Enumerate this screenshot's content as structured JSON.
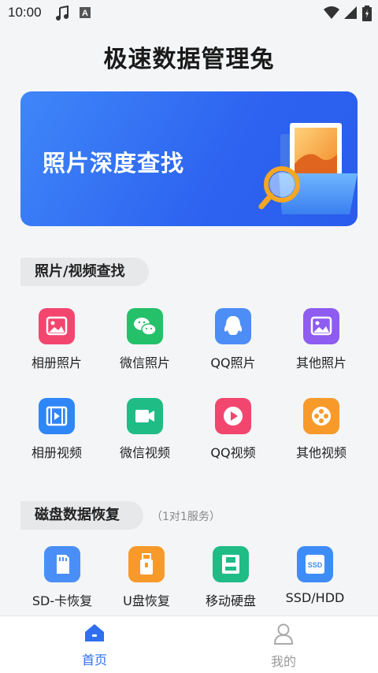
{
  "status_bar": {
    "time": "10:00"
  },
  "app_title": "极速数据管理兔",
  "banner": {
    "title": "照片深度查找"
  },
  "section_media": {
    "title": "照片/视频查找",
    "items": [
      {
        "label": "相册照片",
        "icon": "album-photo-icon",
        "color": "#f2466f"
      },
      {
        "label": "微信照片",
        "icon": "wechat-icon",
        "color": "#25c06a"
      },
      {
        "label": "QQ照片",
        "icon": "qq-icon",
        "color": "#4c8df6"
      },
      {
        "label": "其他照片",
        "icon": "other-photo-icon",
        "color": "#8e5cf0"
      },
      {
        "label": "相册视频",
        "icon": "album-video-icon",
        "color": "#2f86f6"
      },
      {
        "label": "微信视频",
        "icon": "wechat-video-icon",
        "color": "#1fbc86"
      },
      {
        "label": "QQ视频",
        "icon": "qq-video-icon",
        "color": "#f2466f"
      },
      {
        "label": "其他视频",
        "icon": "film-reel-icon",
        "color": "#f79a2a"
      }
    ]
  },
  "section_disk": {
    "title": "磁盘数据恢复",
    "note": "（1对1服务）",
    "items": [
      {
        "label": "SD-卡恢复",
        "icon": "sd-card-icon",
        "color": "#4a8ff7"
      },
      {
        "label": "U盘恢复",
        "icon": "usb-drive-icon",
        "color": "#f79a2a"
      },
      {
        "label": "移动硬盘",
        "icon": "external-disk-icon",
        "color": "#1fbc86"
      },
      {
        "label": "SSD/HDD",
        "icon": "ssd-icon",
        "color": "#3f8cf6",
        "badge": "SSD"
      }
    ]
  },
  "bottom_nav": {
    "tabs": [
      {
        "label": "首页",
        "active": true,
        "color": "#2f6ff0"
      },
      {
        "label": "我的",
        "active": false,
        "color": "#999999"
      }
    ]
  }
}
